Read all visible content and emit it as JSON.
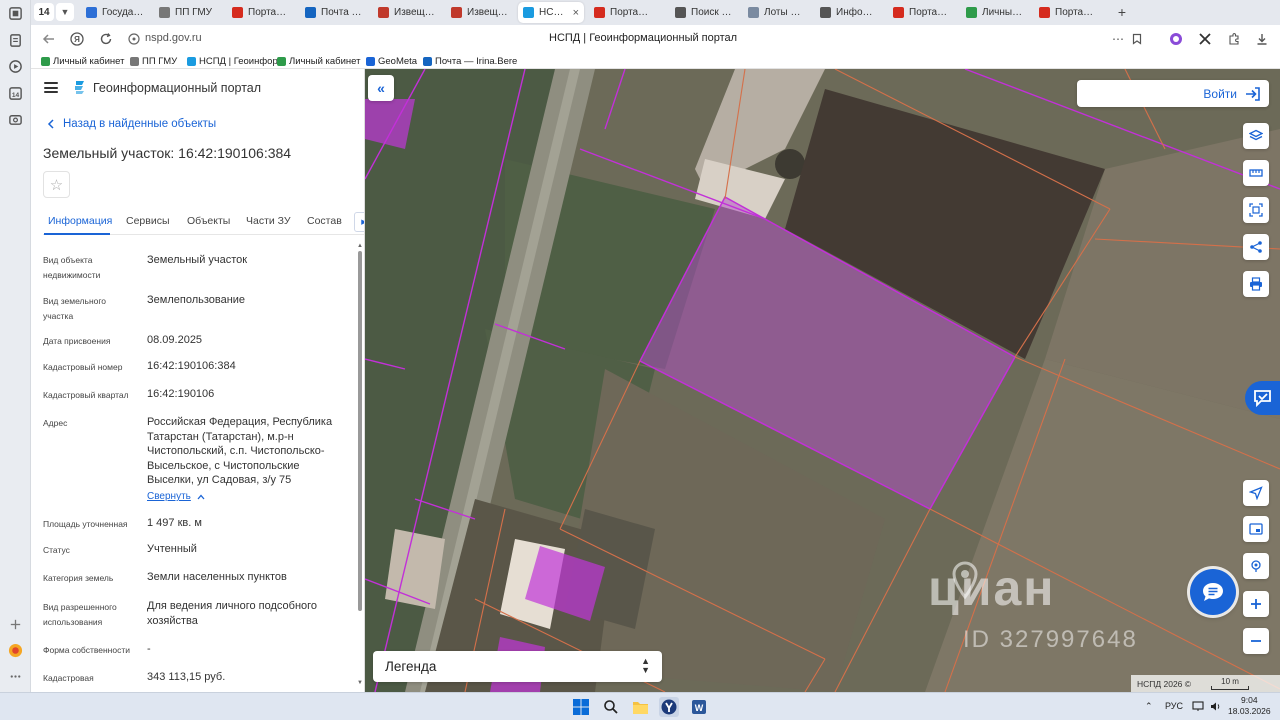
{
  "browser": {
    "tab_count": "14",
    "tabs": [
      {
        "label": "Государств",
        "icon": "gov-icon",
        "color": "#2d6fd6"
      },
      {
        "label": "ПП ГМУ",
        "icon": "emblem-icon",
        "color": "#777777"
      },
      {
        "label": "Портал гос",
        "icon": "flag-icon",
        "color": "#d52b1e"
      },
      {
        "label": "Почта — Ir",
        "icon": "mail-icon",
        "color": "#1565c0"
      },
      {
        "label": "Извещени",
        "icon": "coat-icon",
        "color": "#c0392b"
      },
      {
        "label": "Извещени",
        "icon": "coat-icon",
        "color": "#c0392b"
      },
      {
        "label": "НСПД |",
        "icon": "nspd-icon",
        "color": "#1a9be0",
        "active": true
      },
      {
        "label": "Портал гос",
        "icon": "flag-icon",
        "color": "#d52b1e"
      },
      {
        "label": "Поиск - Ко",
        "icon": "search-site-icon",
        "color": "#555555"
      },
      {
        "label": "Лоты изве",
        "icon": "doc-icon",
        "color": "#7a8aa0"
      },
      {
        "label": "Информац",
        "icon": "doc-icon",
        "color": "#555555"
      },
      {
        "label": "Портал гос",
        "icon": "flag-icon",
        "color": "#d52b1e"
      },
      {
        "label": "Личный ка",
        "icon": "cabinet-icon",
        "color": "#2e9b4a"
      },
      {
        "label": "Портал гос",
        "icon": "flag-icon",
        "color": "#d52b1e"
      }
    ],
    "url": "nspd.gov.ru",
    "page_title": "НСПД | Геоинформационный портал",
    "bookmarks": [
      {
        "label": "Личный кабинет",
        "color": "#2e9b4a"
      },
      {
        "label": "ПП ГМУ",
        "color": "#777777"
      },
      {
        "label": "НСПД | Геоинфор",
        "color": "#1a9be0"
      },
      {
        "label": "Личный кабинет",
        "color": "#2e9b4a"
      },
      {
        "label": "GeoMeta",
        "color": "#1a64d6"
      },
      {
        "label": "Почта — Irina.Bere",
        "color": "#1565c0"
      }
    ]
  },
  "panel": {
    "app_title": "Геоинформационный портал",
    "back_label": "Назад в найденные объекты",
    "object_title": "Земельный участок: 16:42:190106:384",
    "tabs": [
      "Информация",
      "Сервисы",
      "Объекты",
      "Части ЗУ",
      "Состав"
    ],
    "properties": [
      {
        "label": "Вид объекта недвижимости",
        "value": "Земельный участок"
      },
      {
        "label": "Вид земельного участка",
        "value": "Землепользование"
      },
      {
        "label": "Дата присвоения",
        "value": "08.09.2025"
      },
      {
        "label": "Кадастровый номер",
        "value": "16:42:190106:384"
      },
      {
        "label": "Кадастровый квартал",
        "value": "16:42:190106"
      },
      {
        "label": "Адрес",
        "value": "Российская Федерация, Республика Татарстан (Татарстан), м.р-н Чистопольский, с.п. Чистопольско-Высельское, с Чистопольские Выселки, ул Садовая, з/у 75"
      },
      {
        "label": "Площадь уточненная",
        "value": "1 497 кв. м"
      },
      {
        "label": "Статус",
        "value": "Учтенный"
      },
      {
        "label": "Категория земель",
        "value": "Земли населенных пунктов"
      },
      {
        "label": "Вид разрешенного использования",
        "value": "Для ведения личного подсобного хозяйства"
      },
      {
        "label": "Форма собственности",
        "value": "-"
      },
      {
        "label": "Кадастровая",
        "value": "343 113,15 руб."
      }
    ],
    "collapse_label": "Свернуть"
  },
  "map": {
    "login_label": "Войти",
    "legend_label": "Легенда",
    "watermark": "циан",
    "watermark_id": "ID 327997648",
    "copyright": "НСПД 2026 ©",
    "scale_label": "10 m",
    "colors": {
      "accent": "#1a64d6",
      "parcel_fill": "#b14ec7",
      "boundary_magenta": "#c230d8",
      "boundary_orange": "#d4704a"
    }
  },
  "taskbar": {
    "lang": "РУС",
    "time": "9:04",
    "date": "18.03.2026"
  }
}
